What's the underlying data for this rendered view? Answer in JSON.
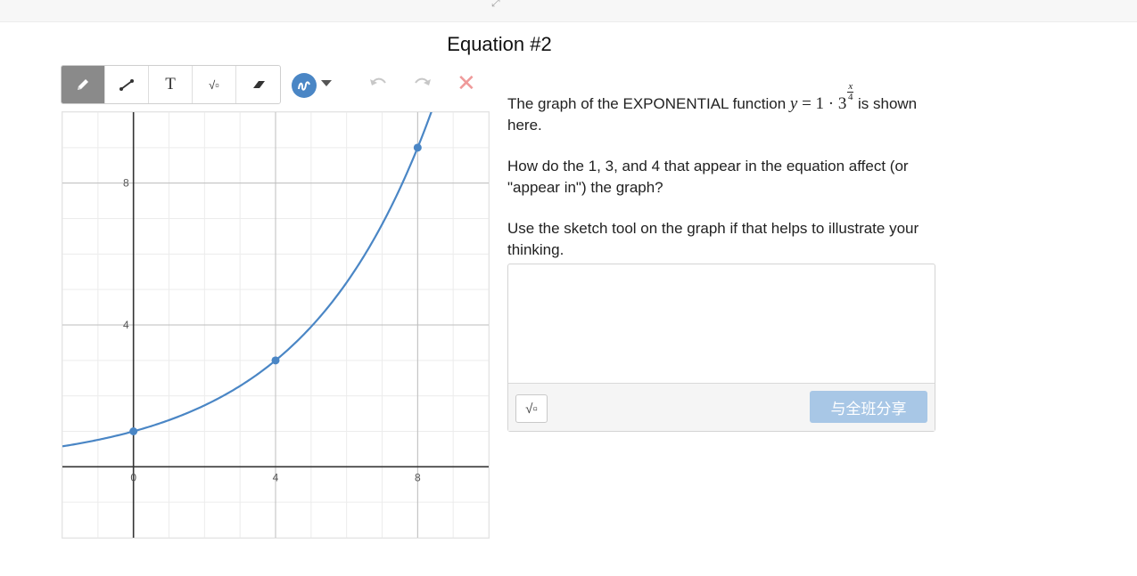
{
  "heading": "Equation #2",
  "toolbar": {
    "tools": [
      {
        "name": "pencil-tool",
        "icon": "pencil-icon"
      },
      {
        "name": "line-tool",
        "icon": "line-segment-icon"
      },
      {
        "name": "text-tool",
        "icon": "text-icon",
        "glyph": "T"
      },
      {
        "name": "math-tool",
        "icon": "square-root-icon",
        "glyph": "√▫"
      },
      {
        "name": "eraser-tool",
        "icon": "eraser-icon"
      }
    ],
    "active_tool": "pencil-tool",
    "pen_color": "#4a86c5",
    "undo_icon": "undo-icon",
    "redo_icon": "redo-icon",
    "clear_icon": "clear-x-icon",
    "clear_glyph": "✕",
    "expand_glyph": "⤢"
  },
  "prompt": {
    "line1_before": "The graph of the EXPONENTIAL function ",
    "equation": {
      "lhs": "y",
      "eq": " = 1 · 3",
      "exp_num": "x",
      "exp_den": "4"
    },
    "line1_after": " is shown here.",
    "paragraph2": "How do the 1, 3, and 4 that appear in the equation affect (or \"appear in\") the graph?",
    "paragraph3": "Use the sketch tool on the graph if that helps to illustrate your thinking."
  },
  "answer_box": {
    "value": "",
    "math_button_glyph": "√▫",
    "share_label": "与全班分享"
  },
  "chart_data": {
    "type": "line",
    "series": [
      {
        "function": "y = 1 * 3^(x/4)",
        "color": "#4a86c5"
      }
    ],
    "points": [
      {
        "x": 0,
        "y": 1
      },
      {
        "x": 4,
        "y": 3
      },
      {
        "x": 8,
        "y": 9
      }
    ],
    "xlim": [
      -2,
      10
    ],
    "ylim": [
      -2,
      10
    ],
    "x_ticks": [
      0,
      4,
      8
    ],
    "y_ticks": [
      4,
      8
    ],
    "tick_labels_x": [
      "0",
      "4",
      "8"
    ],
    "tick_labels_y": [
      "4",
      "8"
    ],
    "grid": true,
    "gridline_step": 1
  }
}
